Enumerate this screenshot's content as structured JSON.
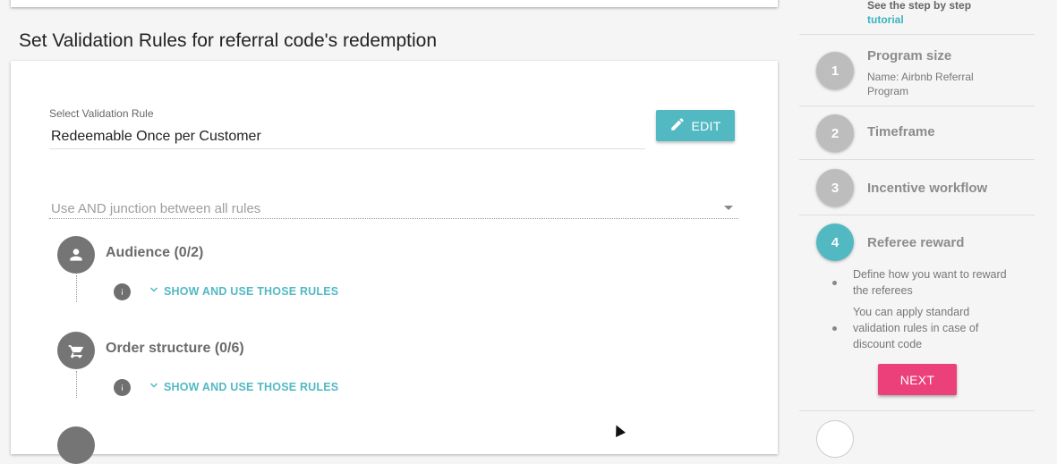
{
  "page": {
    "section_title": "Set Validation Rules for referral code's redemption"
  },
  "validation": {
    "label": "Select Validation Rule",
    "value": "Redeemable Once per Customer",
    "edit_label": "EDIT",
    "junction_text": "Use AND junction between all rules"
  },
  "rules": [
    {
      "title": "Audience (0/2)",
      "icon": "person-icon",
      "link": "SHOW AND USE THOSE RULES"
    },
    {
      "title": "Order structure (0/6)",
      "icon": "cart-icon",
      "link": "SHOW AND USE THOSE RULES"
    }
  ],
  "sidebar": {
    "hint_line1": "See the step by step",
    "hint_link": "tutorial",
    "steps": [
      {
        "number": "1",
        "title": "Program size",
        "subtitle": "Name: Airbnb Referral Program",
        "state": "inactive"
      },
      {
        "number": "2",
        "title": "Timeframe",
        "state": "inactive"
      },
      {
        "number": "3",
        "title": "Incentive workflow",
        "state": "inactive"
      },
      {
        "number": "4",
        "title": "Referee reward",
        "state": "active",
        "bullets": [
          "Define how you want to reward the referees",
          "You can apply standard validation rules in case of discount code"
        ],
        "next_label": "NEXT"
      }
    ]
  },
  "colors": {
    "accent": "#52b9c3",
    "next_button": "#ec407a",
    "rule_icon_bg": "#757575",
    "inactive_step": "#bdbdbd"
  }
}
